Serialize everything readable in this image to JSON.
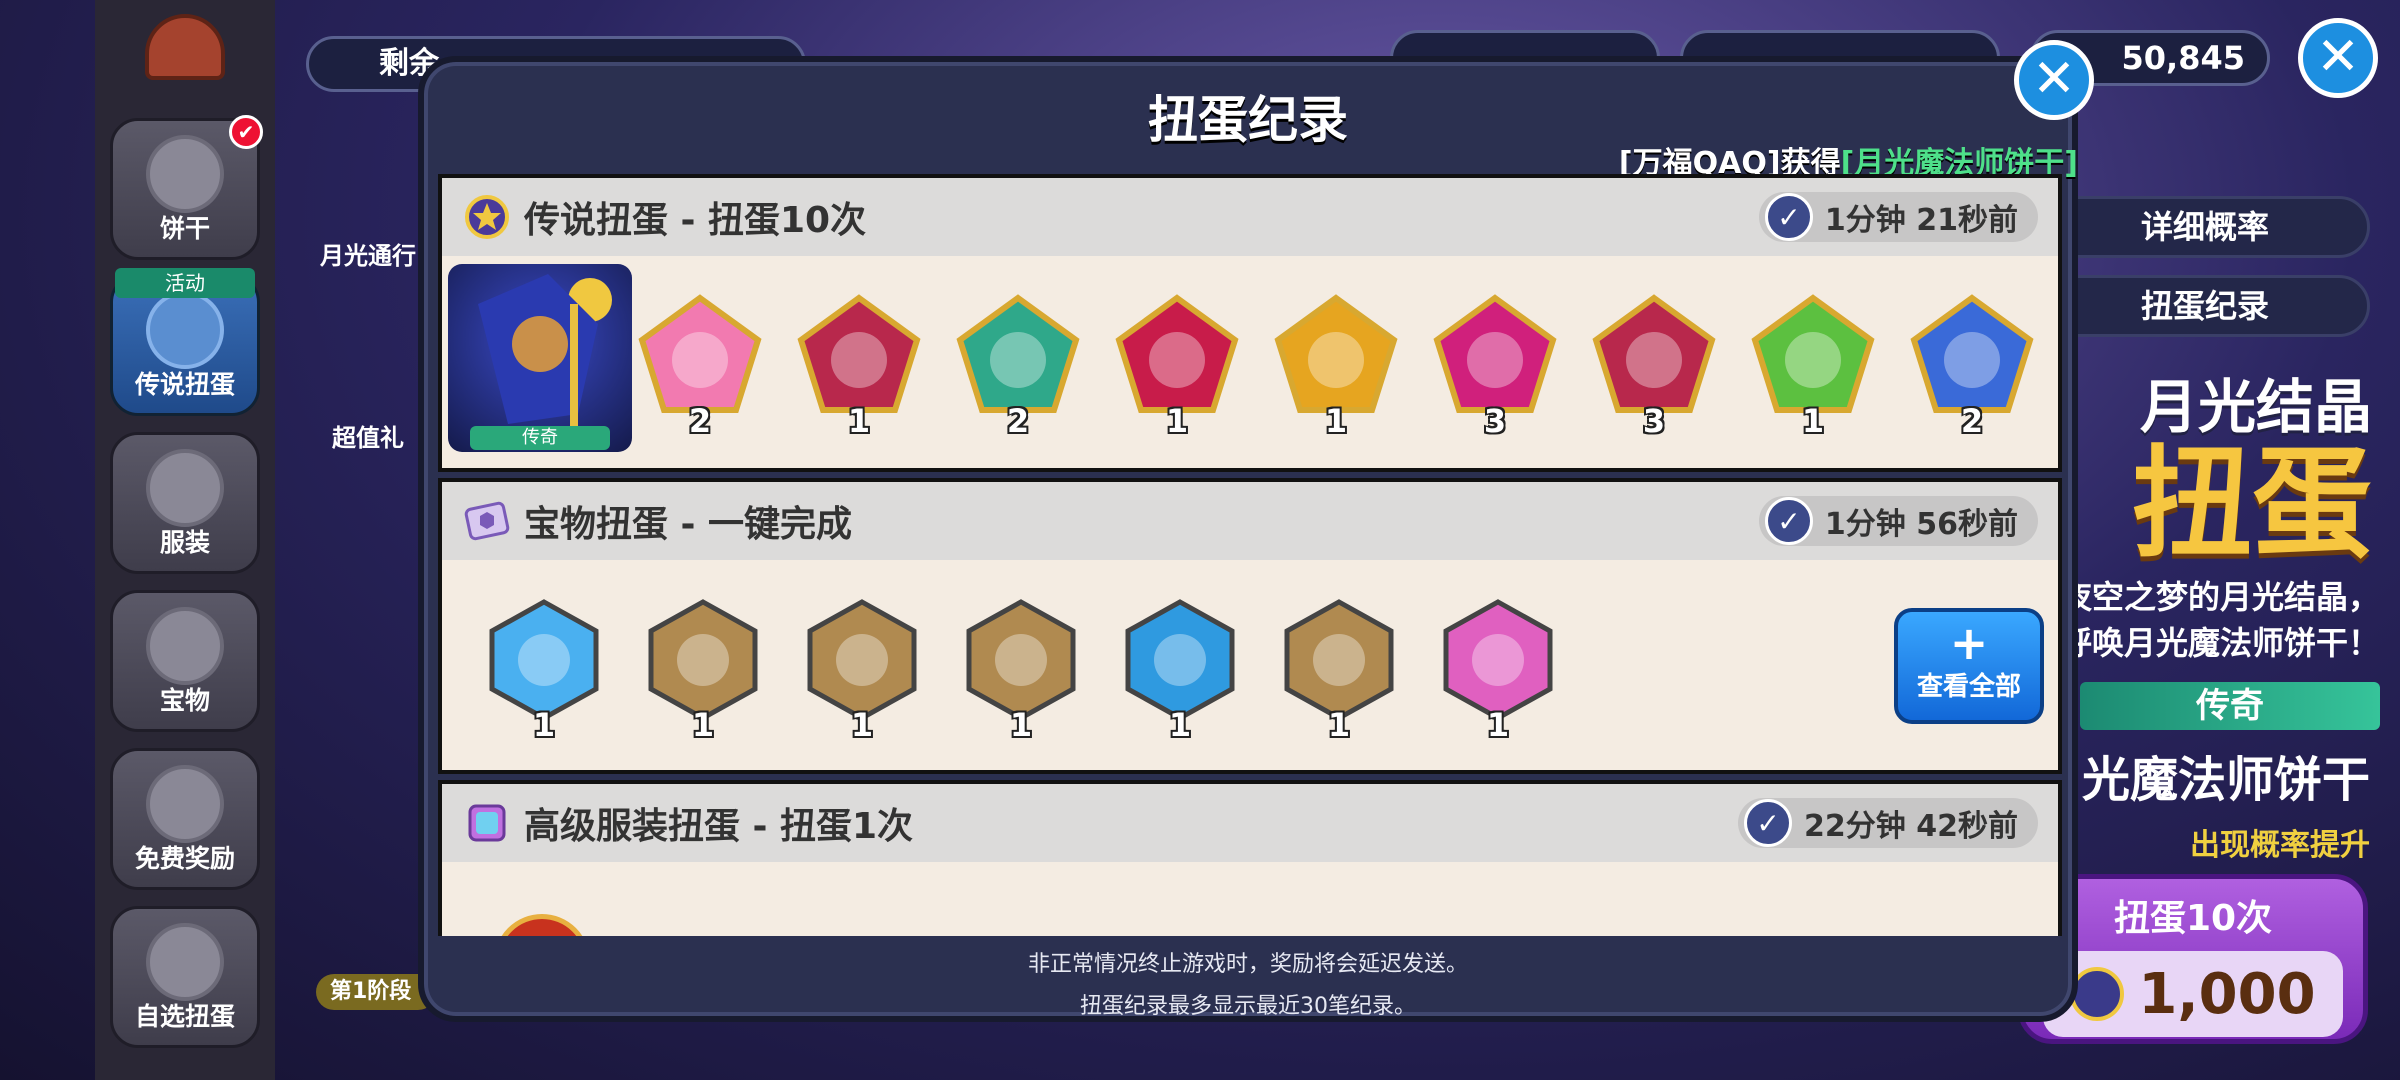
{
  "bg": {
    "sidebar": [
      {
        "label": "饼干",
        "badge": "✔"
      },
      {
        "label": "传说扭蛋",
        "ribbon": "活动"
      },
      {
        "label": "服装"
      },
      {
        "label": "宝物"
      },
      {
        "label": "免费奖励"
      },
      {
        "label": "自选扭蛋"
      }
    ],
    "remaining_label": "剩余",
    "partial_labels": {
      "moon_pass": "月光通行",
      "value_pack": "超值礼",
      "stage": "第1阶段"
    },
    "currency_value": "50,845",
    "right_buttons": {
      "detail_rate": "详细概率",
      "gacha_record": "扭蛋纪录"
    },
    "promo": {
      "title_line1": "月光结晶",
      "title_line2": "扭蛋",
      "desc1": "夜空之梦的月光结晶，",
      "desc2": "呼唤月光魔法师饼干！",
      "rarity": "传奇",
      "cookie_name": "月光魔法师饼干",
      "rate_up": "出现概率提升",
      "pull_label": "扭蛋10次",
      "pull_cost": "1,000"
    }
  },
  "modal": {
    "title": "扭蛋纪录",
    "winner": {
      "player": "[万福QAQ]",
      "got": "获得",
      "item": "[月光魔法师饼干]"
    },
    "sections": [
      {
        "title": "传说扭蛋 - 扭蛋10次",
        "time": "1分钟 21秒前",
        "featured_label": "传奇",
        "items": [
          {
            "icon": "pink-cookie-icon",
            "count": "2",
            "color": "#f27ab0"
          },
          {
            "icon": "dark-hair-cookie-icon",
            "count": "1",
            "color": "#b8284c"
          },
          {
            "icon": "green-witch-cookie-icon",
            "count": "2",
            "color": "#2fa88a"
          },
          {
            "icon": "purple-cat-cookie-icon",
            "count": "1",
            "color": "#c81c4a"
          },
          {
            "icon": "gold-cookie-icon",
            "count": "1",
            "color": "#e6a520"
          },
          {
            "icon": "magenta-cookie-icon",
            "count": "3",
            "color": "#d0207c"
          },
          {
            "icon": "dark-hair-cookie-icon",
            "count": "3",
            "color": "#b8284c"
          },
          {
            "icon": "goggles-cookie-icon",
            "count": "1",
            "color": "#5cc040"
          },
          {
            "icon": "purple-hair-cookie-icon",
            "count": "2",
            "color": "#3a6ad8"
          }
        ]
      },
      {
        "title": "宝物扭蛋 - 一键完成",
        "time": "1分钟 56秒前",
        "view_all": "查看全部",
        "items": [
          {
            "icon": "bow-treasure-icon",
            "count": "1",
            "color": "#4ab0f0"
          },
          {
            "icon": "chest-treasure-icon",
            "count": "1",
            "color": "#b08a50"
          },
          {
            "icon": "chest-treasure-icon",
            "count": "1",
            "color": "#b08a50"
          },
          {
            "icon": "chest-treasure-icon",
            "count": "1",
            "color": "#b08a50"
          },
          {
            "icon": "key-treasure-icon",
            "count": "1",
            "color": "#2f9ae0"
          },
          {
            "icon": "clock-treasure-icon",
            "count": "1",
            "color": "#b08a50"
          },
          {
            "icon": "flame-crown-treasure-icon",
            "count": "1",
            "color": "#e060c0"
          }
        ]
      },
      {
        "title": "高级服装扭蛋 - 扭蛋1次",
        "time": "22分钟 42秒前"
      }
    ],
    "footer_line1": "非正常情况终止游戏时，奖励将会延迟发送。",
    "footer_line2": "扭蛋纪录最多显示最近30笔纪录。"
  }
}
